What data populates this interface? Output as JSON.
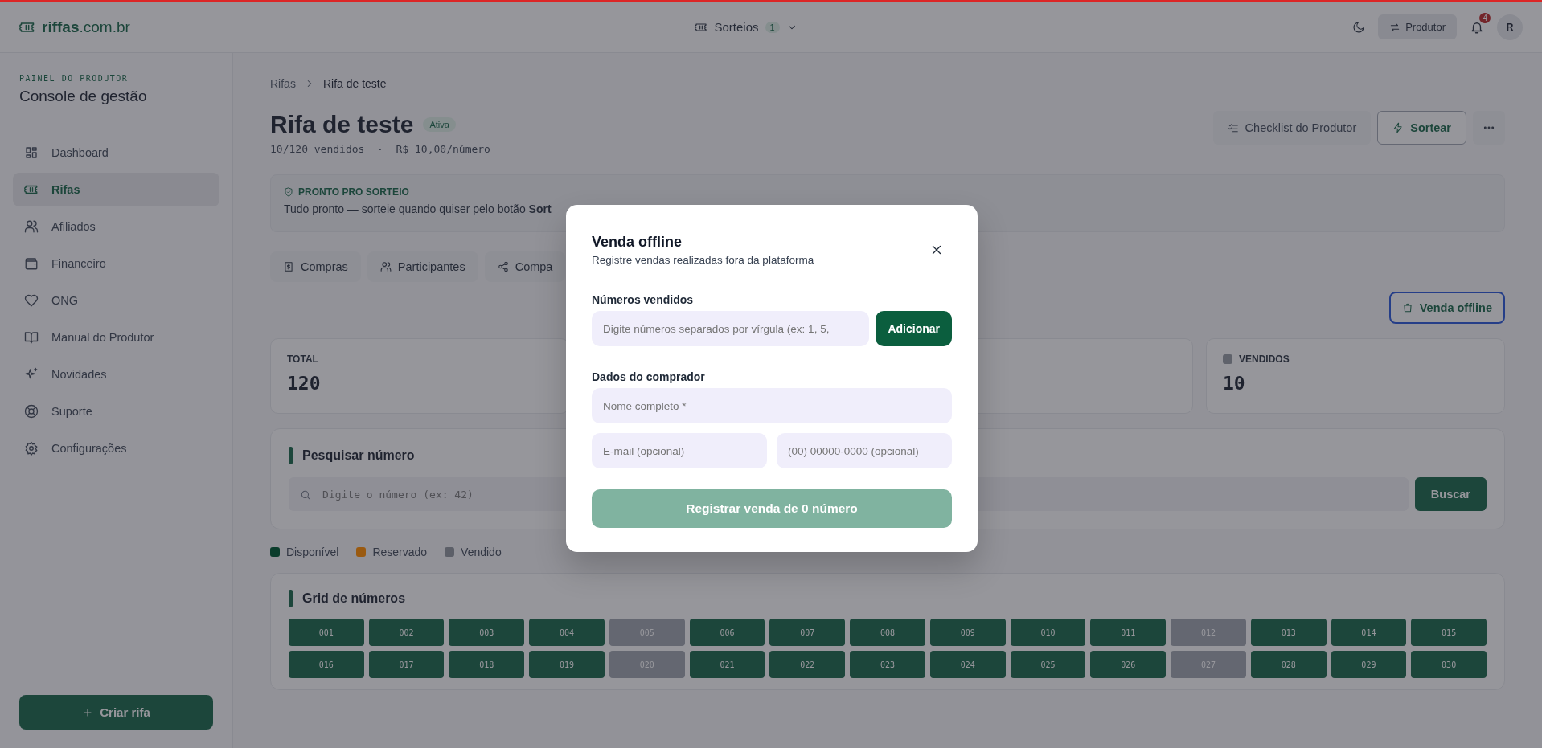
{
  "topbar": {
    "logo_main": "riffas",
    "logo_suffix": ".com.br",
    "menu": {
      "label": "Sorteios",
      "count": "1"
    },
    "role_button": "Produtor",
    "notifications": "4",
    "avatar": "R"
  },
  "sidebar": {
    "eyebrow": "PAINEL DO PRODUTOR",
    "title": "Console de gestão",
    "items": [
      {
        "label": "Dashboard",
        "selected": false
      },
      {
        "label": "Rifas",
        "selected": true
      },
      {
        "label": "Afiliados",
        "selected": false
      },
      {
        "label": "Financeiro",
        "selected": false
      },
      {
        "label": "ONG",
        "selected": false
      },
      {
        "label": "Manual do Produtor",
        "selected": false
      },
      {
        "label": "Novidades",
        "selected": false
      },
      {
        "label": "Suporte",
        "selected": false
      },
      {
        "label": "Configurações",
        "selected": false
      }
    ],
    "create_button": "Criar rifa"
  },
  "breadcrumb": [
    "Rifas",
    "Rifa de teste"
  ],
  "header": {
    "title": "Rifa de teste",
    "status": "Ativa",
    "summary": "10/120 vendidos  ·  R$ 10,00/número",
    "actions": [
      "Checklist do Produtor",
      "Sortear"
    ]
  },
  "banner": {
    "title": "PRONTO PRO SORTEIO",
    "text": "Tudo pronto — sorteie quando quiser pelo botão **Sort**"
  },
  "tabs": [
    {
      "label": "Compras",
      "selected": false
    },
    {
      "label": "Participantes",
      "selected": false
    },
    {
      "label": "Compa",
      "selected": false
    }
  ],
  "offline_button": "Venda offline",
  "stats": [
    {
      "label": "TOTAL",
      "value": "120"
    },
    {
      "label": "VENDIDOS",
      "value": "10",
      "color": "#5f626b"
    }
  ],
  "search": {
    "title": "Pesquisar número",
    "placeholder": "Digite o número (ex: 42)",
    "button": "Buscar"
  },
  "legend": [
    {
      "label": "Disponível",
      "color": "#0b3d2c"
    },
    {
      "label": "Reservado",
      "color": "#9a5a10"
    },
    {
      "label": "Vendido",
      "color": "#5c5f68"
    }
  ],
  "grid": {
    "title": "Grid de números",
    "cells": [
      {
        "label": "001",
        "kind": "available"
      },
      {
        "label": "002",
        "kind": "available"
      },
      {
        "label": "003",
        "kind": "available"
      },
      {
        "label": "004",
        "kind": "available"
      },
      {
        "label": "005",
        "kind": "sold"
      },
      {
        "label": "006",
        "kind": "available"
      },
      {
        "label": "007",
        "kind": "available"
      },
      {
        "label": "008",
        "kind": "available"
      },
      {
        "label": "009",
        "kind": "available"
      },
      {
        "label": "010",
        "kind": "available"
      },
      {
        "label": "011",
        "kind": "available"
      },
      {
        "label": "012",
        "kind": "sold"
      },
      {
        "label": "013",
        "kind": "available"
      },
      {
        "label": "014",
        "kind": "available"
      },
      {
        "label": "015",
        "kind": "available"
      },
      {
        "label": "016",
        "kind": "available"
      },
      {
        "label": "017",
        "kind": "available"
      },
      {
        "label": "018",
        "kind": "available"
      },
      {
        "label": "019",
        "kind": "available"
      },
      {
        "label": "020",
        "kind": "sold"
      },
      {
        "label": "021",
        "kind": "available"
      },
      {
        "label": "022",
        "kind": "available"
      },
      {
        "label": "023",
        "kind": "available"
      },
      {
        "label": "024",
        "kind": "available"
      },
      {
        "label": "025",
        "kind": "available"
      },
      {
        "label": "026",
        "kind": "available"
      },
      {
        "label": "027",
        "kind": "sold"
      },
      {
        "label": "028",
        "kind": "available"
      },
      {
        "label": "029",
        "kind": "available"
      },
      {
        "label": "030",
        "kind": "available"
      }
    ]
  },
  "modal": {
    "title": "Venda offline",
    "subtitle": "Registre vendas realizadas fora da plataforma",
    "numbers_label": "Números vendidos",
    "numbers_placeholder": "Digite números separados por vírgula (ex: 1, 5,",
    "add_button": "Adicionar",
    "buyer_label": "Dados do comprador",
    "name_placeholder": "Nome completo *",
    "email_placeholder": "E-mail (opcional)",
    "phone_placeholder": "(00) 00000-0000 (opcional)",
    "submit": {
      "label": "Registrar venda de 0 número",
      "disabled": true
    }
  }
}
